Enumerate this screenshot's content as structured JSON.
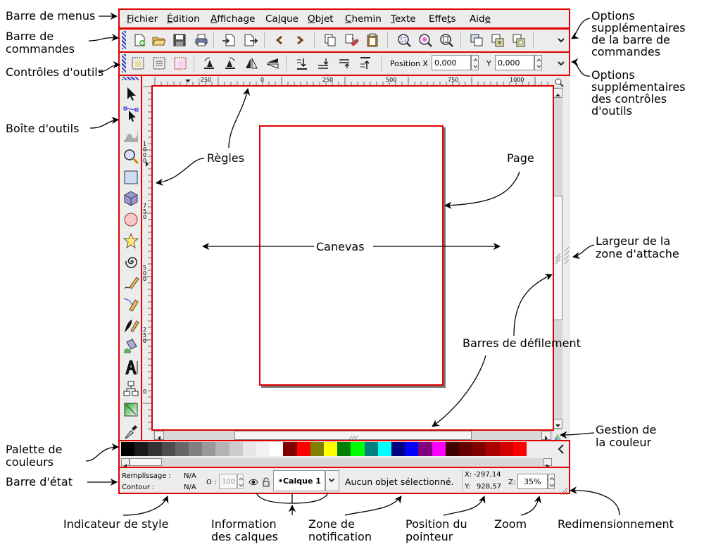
{
  "annotations": {
    "menubar": "Barre de menus",
    "commandbar": [
      "Barre de",
      "commandes"
    ],
    "toolcontrols": "Contrôles d'outils",
    "toolbox": "Boîte d'outils",
    "palette": [
      "Palette de",
      "couleurs"
    ],
    "statusbar": "Barre d'état",
    "cmd_extra": [
      "Options",
      "supplémentaires",
      "de la barre de",
      "commandes"
    ],
    "ctrl_extra": [
      "Options",
      "supplémentaires",
      "des contrôles",
      "d'outils"
    ],
    "snap_width": [
      "Largeur de la",
      "zone d'attache"
    ],
    "color_mgmt": [
      "Gestion de",
      "la couleur"
    ],
    "rulers": "Règles",
    "page": "Page",
    "canvas": "Canevas",
    "scrollbars": "Barres de défilement",
    "style_indicator": "Indicateur de style",
    "layer_info": [
      "Information",
      "des calques"
    ],
    "notification": [
      "Zone de",
      "notification"
    ],
    "pointer_pos": [
      "Position du",
      "pointeur"
    ],
    "zoom": "Zoom",
    "resize": "Redimensionnement"
  },
  "menu": [
    {
      "pre": "",
      "u": "F",
      "post": "ichier"
    },
    {
      "pre": "",
      "u": "É",
      "post": "dition"
    },
    {
      "pre": "",
      "u": "A",
      "post": "ffichage"
    },
    {
      "pre": "Ca",
      "u": "l",
      "post": "que"
    },
    {
      "pre": "",
      "u": "O",
      "post": "bjet"
    },
    {
      "pre": "",
      "u": "C",
      "post": "hemin"
    },
    {
      "pre": "",
      "u": "T",
      "post": "exte"
    },
    {
      "pre": "Effe",
      "u": "t",
      "post": "s"
    },
    {
      "pre": "Aid",
      "u": "e",
      "post": ""
    }
  ],
  "toolcontrols": {
    "pos_x_label": "Position X",
    "pos_x_value": "0,000",
    "y_label": "Y",
    "y_value": "0,000"
  },
  "ruler_h_labels": [
    "-250",
    "0",
    "250",
    "500",
    "750",
    "1000"
  ],
  "ruler_v_labels": [
    "1000",
    "750",
    "500",
    "250",
    "0"
  ],
  "palette_colors": [
    "#000000",
    "#1a1a1a",
    "#333333",
    "#4d4d4d",
    "#666666",
    "#808080",
    "#999999",
    "#b3b3b3",
    "#cccccc",
    "#e6e6e6",
    "#f2f2f2",
    "#ffffff",
    "#800000",
    "#ff0000",
    "#808000",
    "#ffff00",
    "#008000",
    "#00ff00",
    "#008080",
    "#00ffff",
    "#000080",
    "#0000ff",
    "#800080",
    "#ff00ff",
    "#400000",
    "#660000",
    "#800000",
    "#aa0000",
    "#d40000",
    "#ff0000"
  ],
  "status": {
    "fill_label": "Remplissage :",
    "fill_value": "N/A",
    "stroke_label": "Contour :",
    "stroke_value": "N/A",
    "opacity_label": "O :",
    "opacity_value": "100",
    "layer_name": "•Calque 1",
    "notification": "Aucun objet sélectionné.",
    "x_label": "X:",
    "x_value": "-297,14",
    "y_label": "Y:",
    "y_value": "928,57",
    "zoom_label": "Z:",
    "zoom_value": "35%"
  }
}
